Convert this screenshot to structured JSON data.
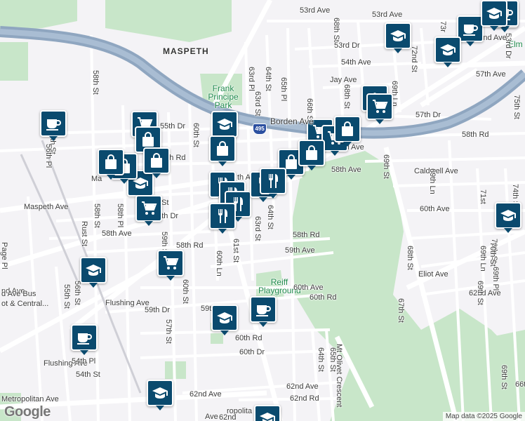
{
  "map": {
    "area_labels": [
      {
        "text": "MASPETH",
        "style": "big"
      },
      {
        "text": "Elm",
        "style": "park"
      }
    ],
    "parks": [
      {
        "text": "Frank Principe Park"
      },
      {
        "text": "Reiff Playground"
      }
    ],
    "highway": {
      "name": "Borden Ave",
      "shield": "495"
    },
    "streets": [
      "53rd Ave",
      "53rd Ave",
      "53rd Dr",
      "53rd Dr",
      "54th Ave",
      "Jay Ave",
      "Grand Ave",
      "Grand Ave",
      "57th Ave",
      "57th Dr",
      "58th Rd",
      "Caldwell Ave",
      "58th Ave",
      "60th Ave",
      "55th Dr",
      "56th Rd",
      "Maspeth Ave",
      "th Ave",
      "57th Dr",
      "58th Ave",
      "58th Rd",
      "58th Rd",
      "59th Ave",
      "nd Ave",
      "Flushing Ave",
      "59th Dr",
      "59t",
      "60th Rd",
      "60th Dr",
      "60th Ave",
      "60th Rd",
      "62nd Ave",
      "62nd Ave",
      "62nd Rd",
      "Metropolitan Ave",
      "Flushing Ave",
      "54th Pl",
      "54th St",
      "Eliot Ave",
      "62nd Ave",
      "63rd St",
      "63rd Pl",
      "64th St",
      "65th Pl",
      "66th St",
      "68th St",
      "68th St",
      "69th Ln",
      "72nd St",
      "73r",
      "75th St",
      "69th St",
      "69th Ln",
      "70th St",
      "71st",
      "74th St",
      "68th St",
      "69th St",
      "69th Pl",
      "69th Ln",
      "70th St",
      "67th St",
      "64th St",
      "65th St",
      "Mt Olivet Crescent",
      "69th St",
      "66t",
      "58th St",
      "56th St",
      "Rust St",
      "58th St",
      "Page Pl",
      "55th St",
      "56th St",
      "57th St",
      "60th St",
      "60th Ln",
      "61st St",
      "59th St",
      "60th St",
      "58th Pl",
      "64th St",
      "63rd St",
      "56th Pl",
      "d Ave Bus",
      "ot & Central...",
      "ropolita",
      "62nd",
      "Ave",
      "Rd",
      "St",
      "Ma"
    ],
    "markers": [
      {
        "type": "cafe",
        "icon": "coffee-cup-icon"
      },
      {
        "type": "cafe",
        "icon": "coffee-cup-icon"
      },
      {
        "type": "cafe",
        "icon": "coffee-cup-icon"
      },
      {
        "type": "cafe",
        "icon": "coffee-cup-icon"
      },
      {
        "type": "cafe",
        "icon": "coffee-cup-icon"
      },
      {
        "type": "cafe",
        "icon": "coffee-cup-icon"
      },
      {
        "type": "school",
        "icon": "graduation-cap-icon"
      },
      {
        "type": "school",
        "icon": "graduation-cap-icon"
      },
      {
        "type": "school",
        "icon": "graduation-cap-icon"
      },
      {
        "type": "school",
        "icon": "graduation-cap-icon"
      },
      {
        "type": "school",
        "icon": "graduation-cap-icon"
      },
      {
        "type": "school",
        "icon": "graduation-cap-icon"
      },
      {
        "type": "school",
        "icon": "graduation-cap-icon"
      },
      {
        "type": "school",
        "icon": "graduation-cap-icon"
      },
      {
        "type": "school",
        "icon": "graduation-cap-icon"
      },
      {
        "type": "school",
        "icon": "graduation-cap-icon"
      },
      {
        "type": "school",
        "icon": "graduation-cap-icon"
      },
      {
        "type": "grocery",
        "icon": "shopping-cart-icon"
      },
      {
        "type": "grocery",
        "icon": "shopping-cart-icon"
      },
      {
        "type": "grocery",
        "icon": "shopping-cart-icon"
      },
      {
        "type": "grocery",
        "icon": "shopping-cart-icon"
      },
      {
        "type": "grocery",
        "icon": "shopping-cart-icon"
      },
      {
        "type": "grocery",
        "icon": "shopping-cart-icon"
      },
      {
        "type": "shopping",
        "icon": "shopping-bag-icon"
      },
      {
        "type": "shopping",
        "icon": "shopping-bag-icon"
      },
      {
        "type": "shopping",
        "icon": "shopping-bag-icon"
      },
      {
        "type": "shopping",
        "icon": "shopping-bag-icon"
      },
      {
        "type": "shopping",
        "icon": "shopping-bag-icon"
      },
      {
        "type": "shopping",
        "icon": "shopping-bag-icon"
      },
      {
        "type": "shopping",
        "icon": "shopping-bag-icon"
      },
      {
        "type": "shopping",
        "icon": "shopping-bag-icon"
      },
      {
        "type": "restaurant",
        "icon": "fork-knife-icon"
      },
      {
        "type": "restaurant",
        "icon": "fork-knife-icon"
      },
      {
        "type": "restaurant",
        "icon": "fork-knife-icon"
      },
      {
        "type": "restaurant",
        "icon": "fork-knife-icon"
      },
      {
        "type": "restaurant",
        "icon": "fork-knife-icon"
      },
      {
        "type": "restaurant",
        "icon": "fork-knife-icon"
      }
    ],
    "colors": {
      "background": "#f4f3f6",
      "park": "#c8e6c9",
      "highway": "#8fa6c0",
      "marker": "#0a4a6e"
    },
    "logo": "Google",
    "attribution": "Map data ©2025 Google"
  }
}
